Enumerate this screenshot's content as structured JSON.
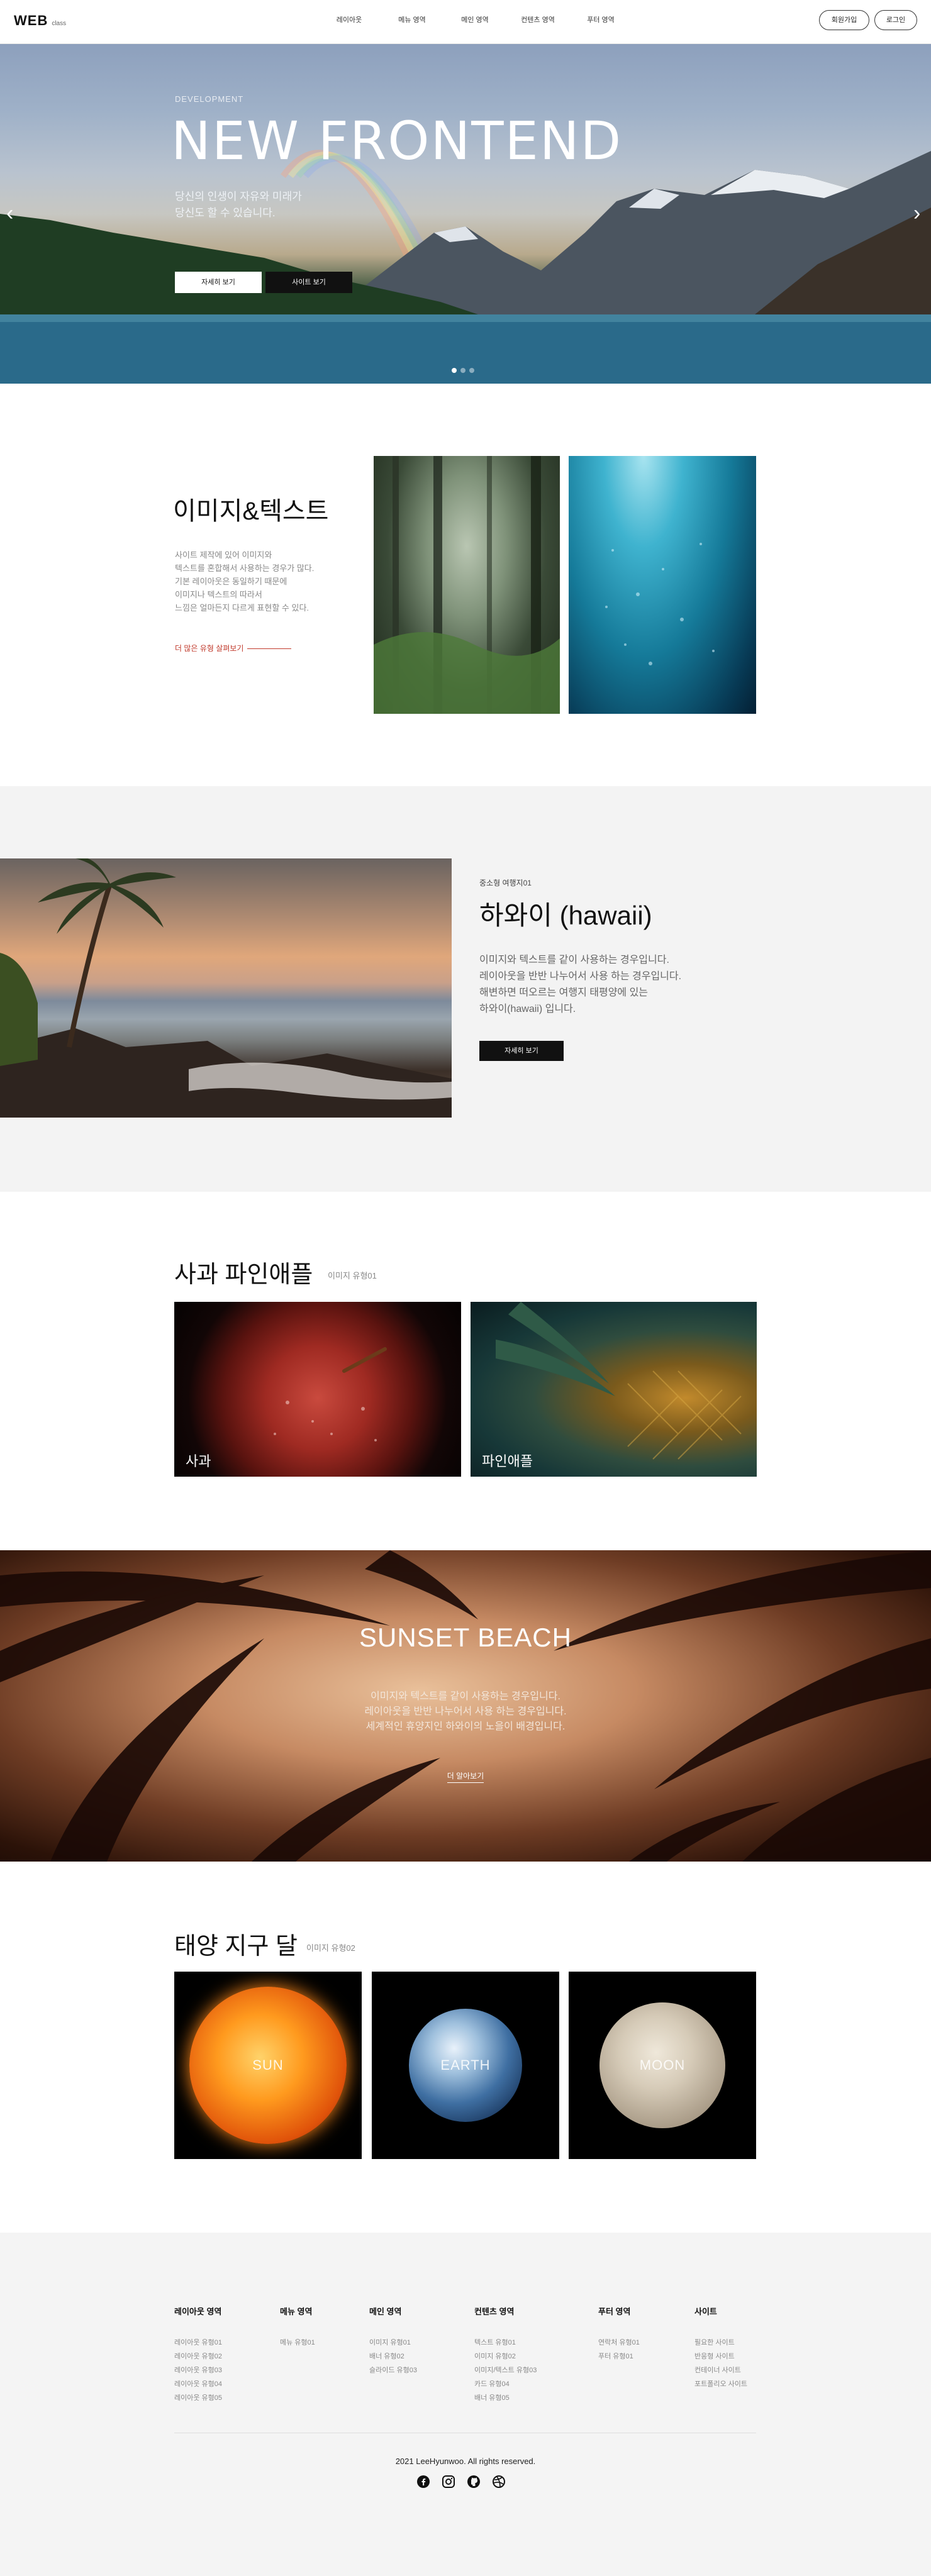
{
  "header": {
    "logo": "WEB",
    "logo_sub": "class",
    "nav": [
      "레이아웃",
      "메뉴 영역",
      "메인 영역",
      "컨텐츠 영역",
      "푸터 영역"
    ],
    "join": "회원가입",
    "login": "로그인"
  },
  "hero": {
    "eyebrow": "DEVELOPMENT",
    "title": "NEW FRONTEND",
    "desc": [
      "당신의 인생이 자유와 미래가",
      "당신도 할 수 있습니다."
    ],
    "btn_detail": "자세히 보기",
    "btn_site": "사이트 보기",
    "prev": "‹",
    "next": "›",
    "active_slide": 1,
    "slide_count": 3
  },
  "image_text": {
    "title": "이미지&텍스트",
    "desc": [
      "사이트 제작에 있어 이미지와",
      "텍스트를 혼합해서 사용하는 경우가 많다.",
      "기본 레이아웃은 동일하기 때문에",
      "이미지나 텍스트의 따라서",
      "느낌은 얼마든지 다르게 표현할 수 있다."
    ],
    "more": "더 많은 유형 살펴보기"
  },
  "hawaii": {
    "eyebrow": "중소형 여행지01",
    "title": "하와이 (hawaii)",
    "desc": [
      "이미지와 텍스트를 같이 사용하는 경우입니다.",
      "레이아웃을 반반 나누어서 사용 하는 경우입니다.",
      "해변하면 떠오르는 여행지 태평양에 있는",
      "하와이(hawaii) 입니다."
    ],
    "btn": "자세히 보기"
  },
  "fruits": {
    "title": "사과 파인애플",
    "subtitle": "이미지 유형01",
    "items": [
      "사과",
      "파인애플"
    ]
  },
  "sunset": {
    "title": "SUNSET BEACH",
    "desc": [
      "이미지와 텍스트를 같이 사용하는 경우입니다.",
      "레이아웃을 반반 나누어서 사용 하는 경우입니다.",
      "세계적인 휴양지인 하와이의 노을이 배경입니다."
    ],
    "more": "더 알아보기"
  },
  "planets": {
    "title": "태양 지구 달",
    "subtitle": "이미지 유형02",
    "items": [
      "SUN",
      "EARTH",
      "MOON"
    ]
  },
  "footer": {
    "columns": [
      {
        "title": "레이아웃 영역",
        "items": [
          "레이아웃 유형01",
          "레이아웃 유형02",
          "레이아웃 유형03",
          "레이아웃 유형04",
          "레이아웃 유형05"
        ]
      },
      {
        "title": "메뉴 영역",
        "items": [
          "메뉴 유형01"
        ]
      },
      {
        "title": "메인 영역",
        "items": [
          "이미지 유형01",
          "배너 유형02",
          "슬라이드 유형03"
        ]
      },
      {
        "title": "컨텐츠 영역",
        "items": [
          "텍스트 유형01",
          "이미지 유형02",
          "이미지/텍스트 유형03",
          "카드 유형04",
          "배너 유형05"
        ]
      },
      {
        "title": "푸터 영역",
        "items": [
          "연락처 유형01",
          "푸터 유형01"
        ]
      },
      {
        "title": "사이트",
        "items": [
          "필요한 사이트",
          "반응형 사이트",
          "컨테이너 사이트",
          "포트폴리오 사이트"
        ]
      }
    ],
    "copyright": "2021 LeeHyunwoo. All rights reserved.",
    "social": [
      "facebook-icon",
      "instagram-icon",
      "github-icon",
      "dribbble-icon"
    ]
  }
}
